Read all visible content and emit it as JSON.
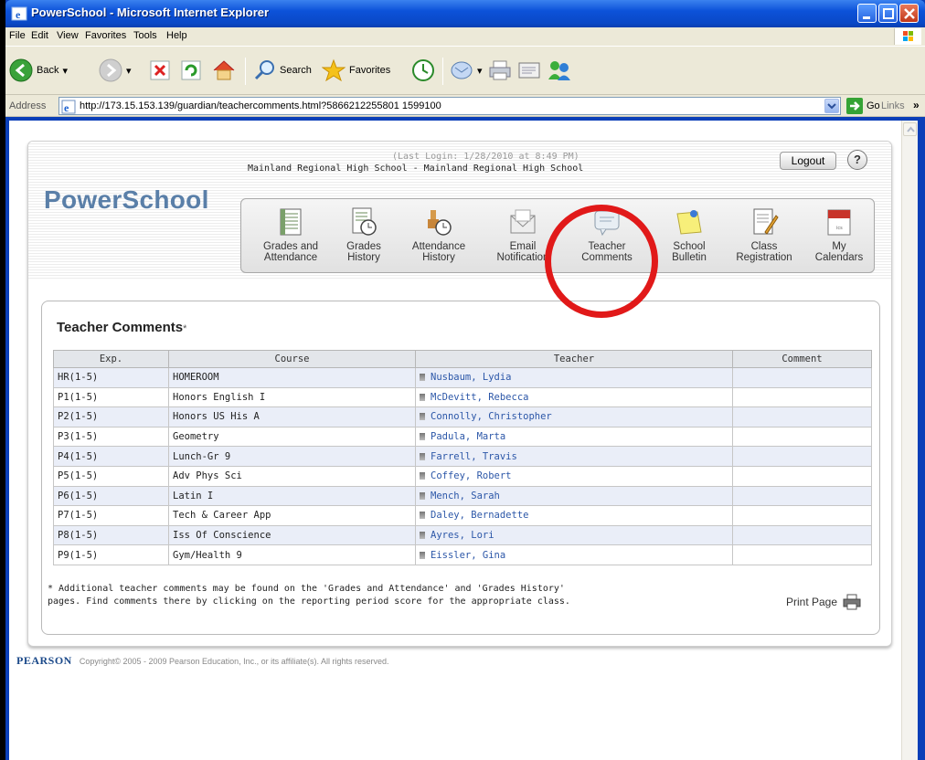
{
  "window": {
    "title": "PowerSchool - Microsoft Internet Explorer"
  },
  "menu": {
    "items": [
      "File",
      "Edit",
      "View",
      "Favorites",
      "Tools",
      "Help"
    ]
  },
  "toolbar": {
    "back_label": "Back",
    "search_label": "Search",
    "favorites_label": "Favorites"
  },
  "address": {
    "label": "Address",
    "url": "http://173.15.153.139/guardian/teachercomments.html?5866212255801 1599100",
    "go_label": "Go",
    "links_label": "Links",
    "chevron": "»"
  },
  "header": {
    "last_login": "(Last Login: 1/28/2010 at 8:49 PM)",
    "school": "Mainland Regional High School - Mainland Regional High School",
    "logout_label": "Logout",
    "help_label": "?",
    "brand": "PowerSchool"
  },
  "nav": [
    {
      "line1": "Grades and",
      "line2": "Attendance",
      "icon": "grades-attendance-icon"
    },
    {
      "line1": "Grades",
      "line2": "History",
      "icon": "grades-history-icon"
    },
    {
      "line1": "Attendance",
      "line2": "History",
      "icon": "attendance-history-icon"
    },
    {
      "line1": "Email",
      "line2": "Notification",
      "icon": "email-icon"
    },
    {
      "line1": "Teacher",
      "line2": "Comments",
      "icon": "teacher-comments-icon"
    },
    {
      "line1": "School",
      "line2": "Bulletin",
      "icon": "bulletin-icon"
    },
    {
      "line1": "Class",
      "line2": "Registration",
      "icon": "class-registration-icon"
    },
    {
      "line1": "My",
      "line2": "Calendars",
      "icon": "calendar-icon"
    }
  ],
  "main": {
    "title": "Teacher Comments",
    "title_marker": "*",
    "columns": [
      "Exp.",
      "Course",
      "Teacher",
      "Comment"
    ],
    "rows": [
      {
        "exp": "HR(1-5)",
        "course": "HOMEROOM",
        "teacher": "Nusbaum, Lydia",
        "comment": ""
      },
      {
        "exp": "P1(1-5)",
        "course": "Honors English I",
        "teacher": "McDevitt, Rebecca",
        "comment": ""
      },
      {
        "exp": "P2(1-5)",
        "course": "Honors US His A",
        "teacher": "Connolly, Christopher",
        "comment": ""
      },
      {
        "exp": "P3(1-5)",
        "course": "Geometry",
        "teacher": "Padula, Marta",
        "comment": ""
      },
      {
        "exp": "P4(1-5)",
        "course": "Lunch-Gr 9",
        "teacher": "Farrell, Travis",
        "comment": ""
      },
      {
        "exp": "P5(1-5)",
        "course": "Adv Phys Sci",
        "teacher": "Coffey, Robert",
        "comment": ""
      },
      {
        "exp": "P6(1-5)",
        "course": "Latin I",
        "teacher": "Mench, Sarah",
        "comment": ""
      },
      {
        "exp": "P7(1-5)",
        "course": "Tech & Career App",
        "teacher": "Daley, Bernadette",
        "comment": ""
      },
      {
        "exp": "P8(1-5)",
        "course": "Iss Of Conscience",
        "teacher": "Ayres, Lori",
        "comment": ""
      },
      {
        "exp": "P9(1-5)",
        "course": "Gym/Health 9",
        "teacher": "Eissler, Gina",
        "comment": ""
      }
    ],
    "footnote_line1": "* Additional teacher comments may be found on the 'Grades and Attendance' and 'Grades History'",
    "footnote_line2": "pages. Find comments there by clicking on the reporting period score for the appropriate class.",
    "print_label": "Print Page"
  },
  "footer": {
    "pearson": "PEARSON",
    "copyright": "Copyright© 2005 - 2009 Pearson Education, Inc., or its affiliate(s). All rights reserved."
  },
  "colors": {
    "xp_title": "#0a48c6",
    "link_blue": "#2c57a8",
    "brand_blue": "#5a7fa8",
    "highlight_red": "#e11919",
    "row_alt": "#eaeef8"
  }
}
